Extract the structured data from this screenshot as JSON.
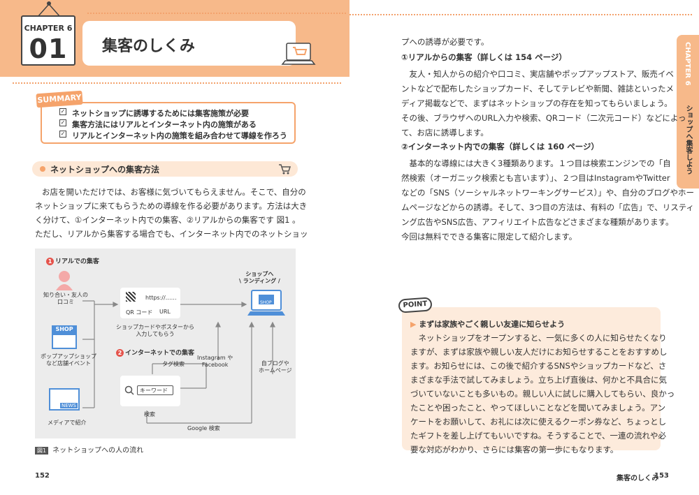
{
  "left": {
    "chapter_label": "CHAPTER 6",
    "chapter_num": "01",
    "title": "集客のしくみ",
    "summary_tag": "SUMMARY",
    "summary_items": [
      "ネットショップに誘導するためには集客施策が必要",
      "集客方法にはリアルとインターネット内の施策がある",
      "リアルとインターネット内の施策を組み合わせて導線を作ろう"
    ],
    "section_title": "ネットショップへの集客方法",
    "body_lines": [
      "お店を開いただけでは、お客様に気づいてもらえません。そこで、自分の",
      "ネットショップに来てもらうための導線を作る必要があります。方法は大き",
      "く分けて、①インターネット内での集客、②リアルからの集客です 図1 。",
      "ただし、リアルから集客する場合でも、インターネット内でのネットショッ"
    ],
    "diagram": {
      "real_head": "リアルでの集客",
      "real_num": "1",
      "friends": "知り合い・友人の\n口コミ",
      "popup": "ポップアップショップ\nなど店舗イベント",
      "media": "メディアで紹介",
      "shop_sign": "SHOP",
      "news": "NEWS",
      "qr_url": "https://……",
      "qr_label": "QR コード",
      "url_label": "URL",
      "card_text": "ショップカードやポスターから\n入力してもらう",
      "landing": "ショップへ\n\\ ランディング /",
      "net_head": "インターネットでの集客",
      "net_num": "2",
      "tag_search": "タグ検索",
      "instagram": "Instagram や\nFacebook",
      "blog": "自ブログや\nホームページ",
      "keyword": "キーワード",
      "search": "検索",
      "google": "Google 検索",
      "laptop_shop": "SHOP"
    },
    "fig_tag": "図1",
    "fig_caption": "ネットショップへの人の流れ",
    "page_number": "152"
  },
  "right": {
    "tab_chapter": "CHAPTER 6",
    "tab_title": "ショップへ集客しよう",
    "lines": [
      "プへの誘導が必要です。",
      "①リアルからの集客（詳しくは 154 ページ）",
      "　友人・知人からの紹介や口コミ、実店舗やポップアップストア、販売イベ",
      "ントなどで配布したショップカード、そしてテレビや新聞、雑誌といったメ",
      "ディア掲載などで、まずはネットショップの存在を知ってもらいましょう。",
      "その後、ブラウザへのURL入力や検索、QRコード（二次元コード）などによっ",
      "て、お店に誘導します。",
      "②インターネット内での集客（詳しくは 160 ページ）",
      "　基本的な導線には大きく3種類あります。１つ目は検索エンジンでの「自",
      "然検索（オーガニック検索とも言います）」、２つ目はInstagramやTwitter",
      "などの「SNS（ソーシャルネットワーキングサービス）」や、自分のブログやホー",
      "ムページなどからの誘導。そして、3つ目の方法は、有料の「広告」で、リスティ",
      "ング広告やSNS広告、アフィリエイト広告などさまざまな種類があります。",
      "今回は無料でできる集客に限定して紹介します。"
    ],
    "point_tag": "POINT",
    "point_head": "まずは家族やごく親しい友達に知らせよう",
    "point_lines": [
      "　ネットショップをオープンすると、一気に多くの人に知らせたくなり",
      "ますが、まずは家族や親しい友人だけにお知らせすることをおすすめし",
      "ます。お知らせには、この後で紹介するSNSやショップカードなど、さ",
      "まざまな手法で試してみましょう。立ち上げ直後は、何かと不具合に気",
      "づいていないことも多いもの。親しい人に試しに購入してもらい、良かっ",
      "たことや困ったこと、やってほしいことなどを聞いてみましょう。アン",
      "ケートをお願いして、お礼には次に使えるクーポン券など、ちょっとし",
      "たギフトを差し上げてもいいですね。そうすることで、一連の流れや必",
      "要な対応がわかり、さらには集客の第一歩にもなります。"
    ],
    "footer_title": "集客のしくみ",
    "page_number": "153"
  },
  "colors": {
    "accent": "#f5a36b",
    "band": "#f7b98a",
    "red": "#e5534b"
  },
  "icons": [
    "cart-icon",
    "laptop-icon",
    "person-icon",
    "shop-icon",
    "newspaper-icon",
    "qr-icon",
    "search-icon"
  ]
}
